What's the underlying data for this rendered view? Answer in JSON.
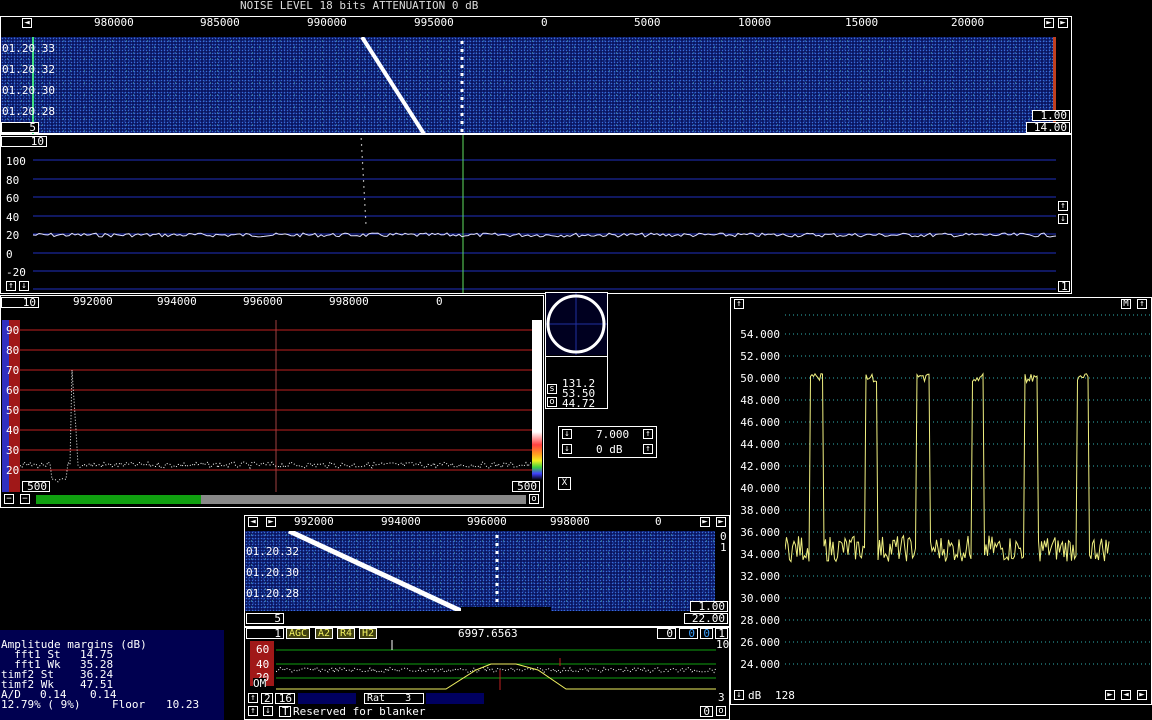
{
  "header": {
    "status_text": "NOISE LEVEL 18 bits ATTENUATION 0 dB"
  },
  "wide_waterfall": {
    "freq_labels": [
      "980000",
      "985000",
      "990000",
      "995000",
      "0",
      "5000",
      "10000",
      "15000",
      "20000"
    ],
    "time_labels": [
      "01.20.33",
      "01.20.32",
      "01.20.30",
      "01.20.28"
    ],
    "avg_value": "5",
    "gain_value": "1.00",
    "zero_value": "14.00"
  },
  "wide_spectrum": {
    "avg_value": "10",
    "y_labels": [
      "100",
      "80",
      "60",
      "40",
      "20",
      "0",
      "-20"
    ],
    "right_value": "1"
  },
  "hires": {
    "avg_value": "10",
    "freq_labels": [
      "992000",
      "994000",
      "996000",
      "998000",
      "0"
    ],
    "y_labels": [
      "90",
      "80",
      "70",
      "60",
      "50",
      "40",
      "30",
      "20"
    ],
    "left_box": "500",
    "right_box": "500",
    "bottom_right_btn": "o"
  },
  "coherent": {
    "s_label": "s",
    "o_label": "o",
    "values": [
      "131.2",
      "53.50",
      "44.72"
    ]
  },
  "freq_control": {
    "freq_value": "7.000",
    "db_value": "0 dB",
    "close_label": "X"
  },
  "baseband_waterfall": {
    "freq_labels": [
      "992000",
      "994000",
      "996000",
      "998000",
      "0"
    ],
    "time_labels": [
      "01.20.32",
      "01.20.30",
      "01.20.28"
    ],
    "right_top": "0",
    "right_mid": "1",
    "avg_value": "5",
    "gain_value": "1.00",
    "zero_value": "22.00"
  },
  "baseband": {
    "bw_value": "1",
    "tags": [
      "AGC",
      "A2",
      "R4",
      "H2"
    ],
    "freq_readout": "6997.6563",
    "right_boxes": [
      "0",
      "0",
      "0",
      "1"
    ],
    "y_labels": [
      "60",
      "40",
      "20"
    ],
    "om_label": "OM",
    "scale_right": "10",
    "scale_right_low": "3",
    "row2_left": [
      "2",
      "16"
    ],
    "rat_label": "Rat",
    "rat_value": "3",
    "blanker_text": "Reserved for blanker",
    "blanker_letter": "T",
    "blanker_right": "0"
  },
  "amplitude_margins": {
    "title": "Amplitude margins (dB)",
    "rows": [
      {
        "label": "  fft1 St",
        "value": "14.75"
      },
      {
        "label": "  fft1 Wk",
        "value": "35.28"
      },
      {
        "label": "timf2 St",
        "value": "36.24"
      },
      {
        "label": "timf2 Wk",
        "value": "47.51"
      }
    ],
    "ad_label": "A/D",
    "ad_values": [
      "0.14",
      "0.14"
    ],
    "cpu_text": "12.79% ( 9%)",
    "floor_label": "Floor",
    "floor_value": "10.23"
  },
  "meter": {
    "m_label": "M",
    "y_labels": [
      "54.000",
      "52.000",
      "50.000",
      "48.000",
      "46.000",
      "44.000",
      "42.000",
      "40.000",
      "38.000",
      "36.000",
      "34.000",
      "32.000",
      "30.000",
      "28.000",
      "26.000",
      "24.000"
    ],
    "db_label": "dB",
    "db_value": "128"
  },
  "colors": {
    "grid_blue": "#2030c0",
    "grid_red": "#c02020",
    "trace_yellow": "#f0f080",
    "waterfall": "#0a1560"
  }
}
